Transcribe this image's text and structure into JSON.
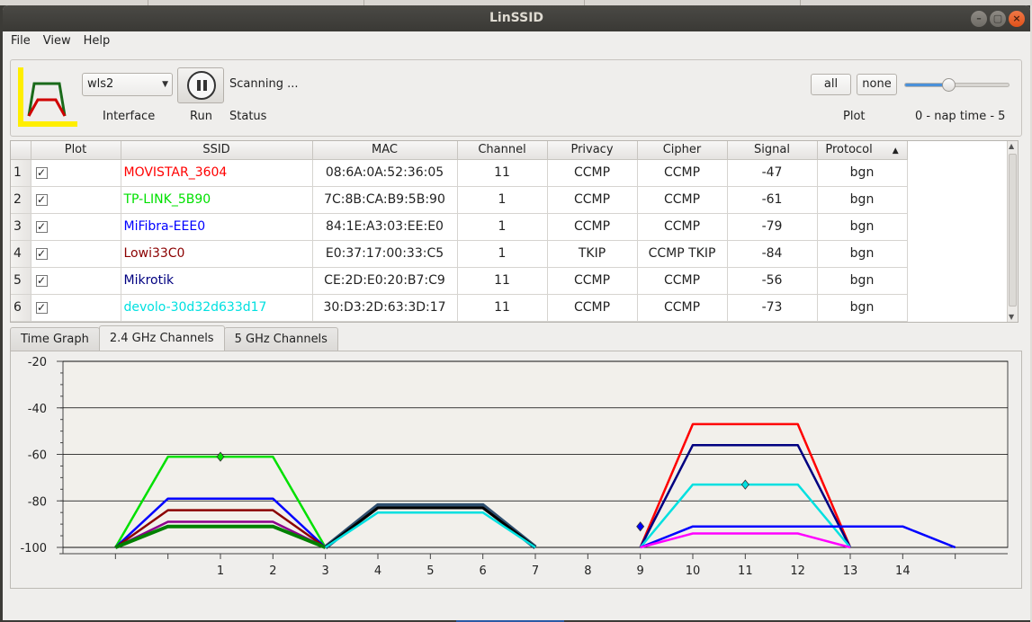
{
  "window": {
    "title": "LinSSID",
    "buttons": [
      "–",
      "▢",
      "×"
    ]
  },
  "menu": [
    "File",
    "View",
    "Help"
  ],
  "toolbar": {
    "interface_value": "wls2",
    "interface_label": "Interface",
    "run_label": "Run",
    "status_value": "Scanning ...",
    "status_label": "Status",
    "all_label": "all",
    "none_label": "none",
    "plot_label": "Plot",
    "nap_label": "0 - nap time - 5",
    "nap_value": 2
  },
  "table": {
    "headers": [
      "",
      "Plot",
      "SSID",
      "MAC",
      "Channel",
      "Privacy",
      "Cipher",
      "Signal",
      "Protocol"
    ],
    "rows": [
      {
        "n": "1",
        "ssid": "MOVISTAR_3604",
        "color": "#ff0000",
        "mac": "08:6A:0A:52:36:05",
        "channel": "11",
        "privacy": "CCMP",
        "cipher": "CCMP",
        "signal": "-47",
        "protocol": "bgn"
      },
      {
        "n": "2",
        "ssid": "TP-LINK_5B90",
        "color": "#00e000",
        "mac": "7C:8B:CA:B9:5B:90",
        "channel": "1",
        "privacy": "CCMP",
        "cipher": "CCMP",
        "signal": "-61",
        "protocol": "bgn"
      },
      {
        "n": "3",
        "ssid": "MiFibra-EEE0",
        "color": "#0000ff",
        "mac": "84:1E:A3:03:EE:E0",
        "channel": "1",
        "privacy": "CCMP",
        "cipher": "CCMP",
        "signal": "-79",
        "protocol": "bgn"
      },
      {
        "n": "4",
        "ssid": "Lowi33C0",
        "color": "#8b0000",
        "mac": "E0:37:17:00:33:C5",
        "channel": "1",
        "privacy": "TKIP",
        "cipher": "CCMP TKIP",
        "signal": "-84",
        "protocol": "bgn"
      },
      {
        "n": "5",
        "ssid": "Mikrotik",
        "color": "#000080",
        "mac": "CE:2D:E0:20:B7:C9",
        "channel": "11",
        "privacy": "CCMP",
        "cipher": "CCMP",
        "signal": "-56",
        "protocol": "bgn"
      },
      {
        "n": "6",
        "ssid": "devolo-30d32d633d17",
        "color": "#00e0e0",
        "mac": "30:D3:2D:63:3D:17",
        "channel": "11",
        "privacy": "CCMP",
        "cipher": "CCMP",
        "signal": "-73",
        "protocol": "bgn"
      }
    ]
  },
  "tabs": [
    "Time Graph",
    "2.4 GHz Channels",
    "5 GHz Channels"
  ],
  "active_tab": 1,
  "chart_data": {
    "type": "line",
    "xlim": [
      -2,
      16
    ],
    "ylim": [
      -100,
      -20
    ],
    "x_tick_labels": [
      "1",
      "2",
      "3",
      "4",
      "5",
      "6",
      "7",
      "8",
      "9",
      "10",
      "11",
      "12",
      "13",
      "14"
    ],
    "y_tick_labels": [
      "-20",
      "-40",
      "-60",
      "-80",
      "-100"
    ],
    "grid": "horizontal",
    "series": [
      {
        "color": "#00e000",
        "center": 1,
        "signal": -61,
        "marker": true
      },
      {
        "color": "#0000ff",
        "center": 1,
        "signal": -79
      },
      {
        "color": "#8b0000",
        "center": 1,
        "signal": -84
      },
      {
        "color": "#8b008b",
        "center": 1,
        "signal": -89
      },
      {
        "color": "#008000",
        "center": 1,
        "signal": -91,
        "width": 4
      },
      {
        "color": "#2f4f6f",
        "center": 5,
        "signal": -82,
        "width": 5
      },
      {
        "color": "#000000",
        "center": 5,
        "signal": -83,
        "width": 3
      },
      {
        "color": "#00e0e0",
        "center": 5,
        "signal": -85
      },
      {
        "color": "#ff0000",
        "center": 11,
        "signal": -47
      },
      {
        "color": "#000080",
        "center": 11,
        "signal": -56
      },
      {
        "color": "#00e0e0",
        "center": 11,
        "signal": -73,
        "marker": true
      },
      {
        "color": "#0000ff",
        "center": 11,
        "signal": -91,
        "wide": true,
        "marker_left": true
      },
      {
        "color": "#ff00ff",
        "center": 11,
        "signal": -94
      }
    ]
  }
}
